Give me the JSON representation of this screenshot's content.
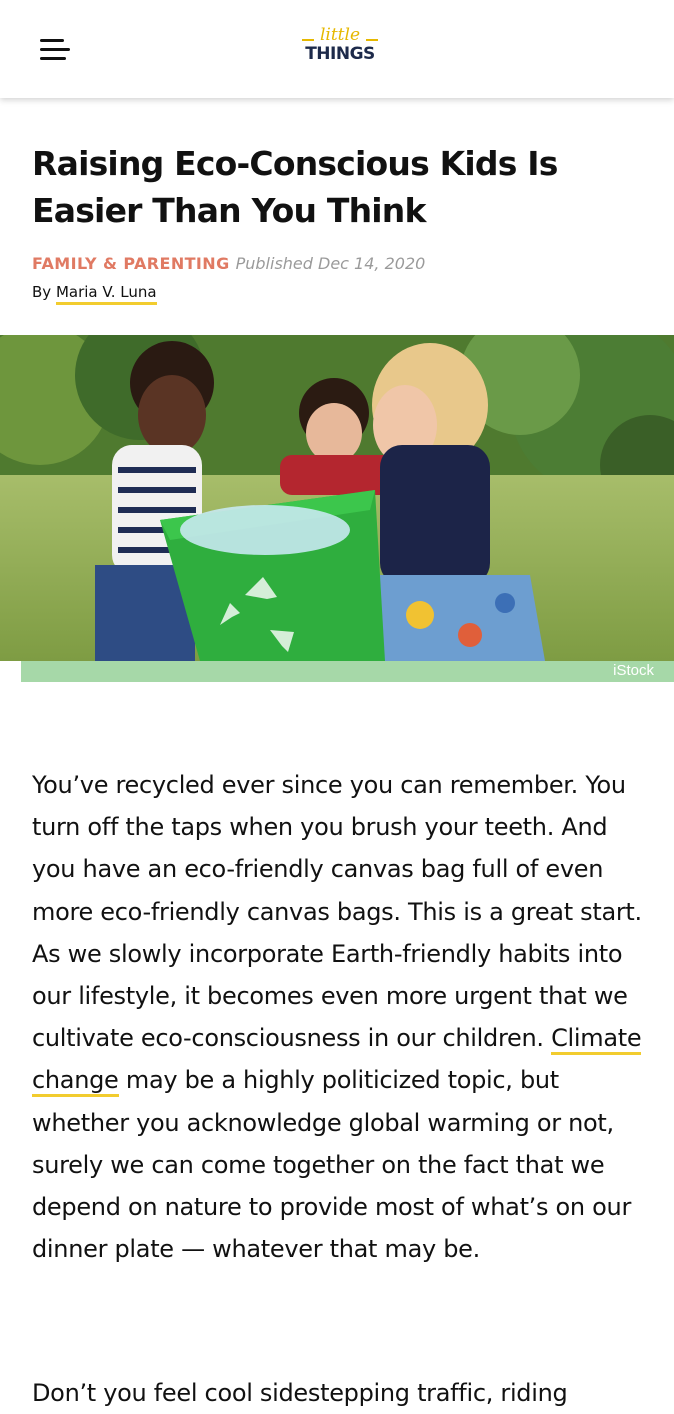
{
  "header": {
    "menu_icon": "hamburger-menu-icon",
    "logo_top": "little",
    "logo_bottom": "THINGS"
  },
  "article": {
    "title": "Raising Eco-Conscious Kids Is Easier Than You Think",
    "category": "FAMILY & PARENTING",
    "published": "Published Dec 14, 2020",
    "byline_prefix": "By",
    "author": "Maria V. Luna",
    "image_credit": "iStock",
    "paragraph1_before_link": "You’ve recycled ever since you can remember. You turn off the taps when you brush your teeth. And you have an eco-friendly canvas bag full of even more eco-friendly canvas bags. This is a great start. As we slowly incorporate Earth-friendly habits into our lifestyle, it becomes even more urgent that we cultivate eco-consciousness in our children.",
    "paragraph1_link": "Climate change",
    "paragraph1_after_link": "may be a highly politicized topic, but whether you acknowledge global warming or not, surely we can come together on the fact that we depend on nature to provide most of what’s on our dinner plate — whatever that may be.",
    "paragraph2_start": "Don’t you feel cool sidestepping traffic, riding"
  },
  "colors": {
    "category": "#e07a63",
    "link_underline": "#f2cc2e",
    "credit_bar": "#a6d8a8",
    "logo_yellow": "#e6b800",
    "logo_navy": "#1d2a4a"
  }
}
